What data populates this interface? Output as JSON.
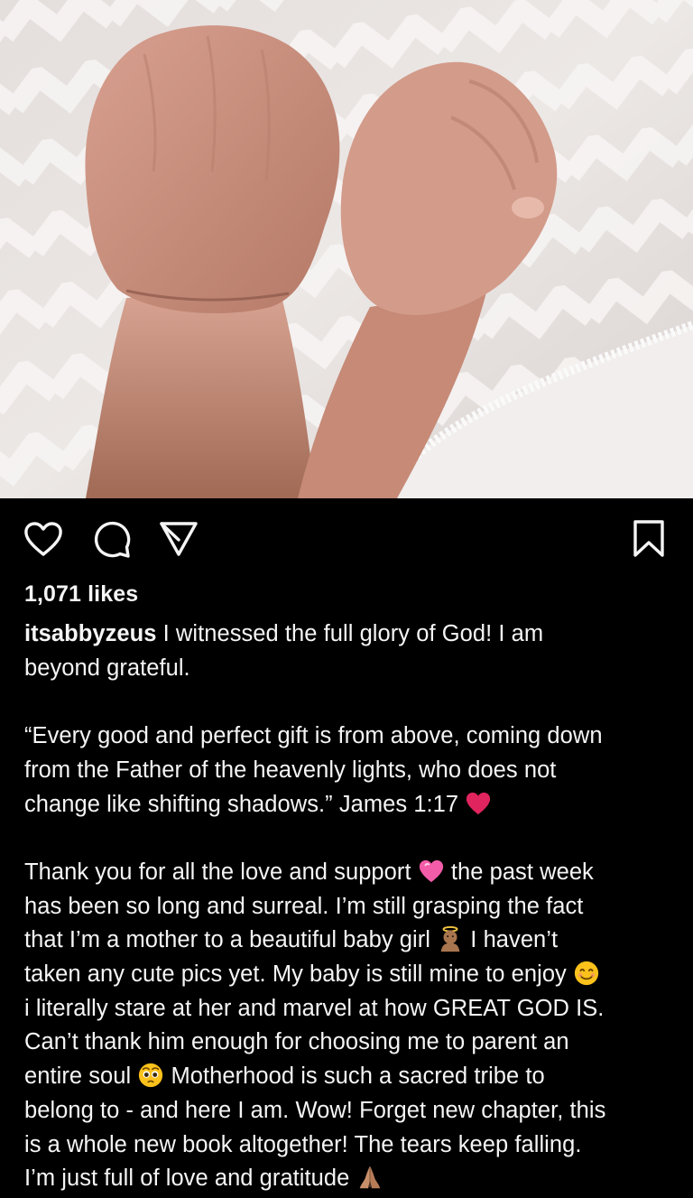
{
  "post": {
    "image_alt": "Baby hands on a chevron blanket",
    "likes_label": "1,071 likes",
    "username": "itsabbyzeus",
    "caption": {
      "line1": "I witnessed the full glory of God! I am",
      "line2": "beyond grateful.",
      "p2_l1": "“Every good and perfect gift is from above, coming down",
      "p2_l2": "from the Father of the heavenly lights, who does not",
      "p2_l3": "change like shifting shadows.” James 1:17",
      "p3_l1a": "Thank you for all the love and support",
      "p3_l1b": "the past week",
      "p3_l2": "has been so long and surreal. I’m still grasping the fact",
      "p3_l3a": "that I’m a mother to a beautiful baby girl",
      "p3_l3b": "I haven’t",
      "p3_l4a": "taken any cute pics yet. My baby is still mine to enjoy",
      "p3_l5": "i literally stare at her and marvel at how GREAT GOD IS.",
      "p3_l6": "Can’t thank him enough for choosing me to parent an",
      "p3_l7a": "entire soul",
      "p3_l7b": "Motherhood is such a sacred tribe to",
      "p3_l8": "belong to - and here I am. Wow! Forget new chapter, this",
      "p3_l9": "is a whole new book altogether! The tears keep falling.",
      "p3_l10a": "I’m just full of love and gratitude"
    }
  },
  "icons": {
    "like": "heart-outline-icon",
    "comment": "comment-bubble-icon",
    "share": "paper-plane-icon",
    "save": "bookmark-icon"
  },
  "colors": {
    "background": "#000000",
    "text": "#f5f5f5",
    "heart_red": "#e0245e"
  }
}
